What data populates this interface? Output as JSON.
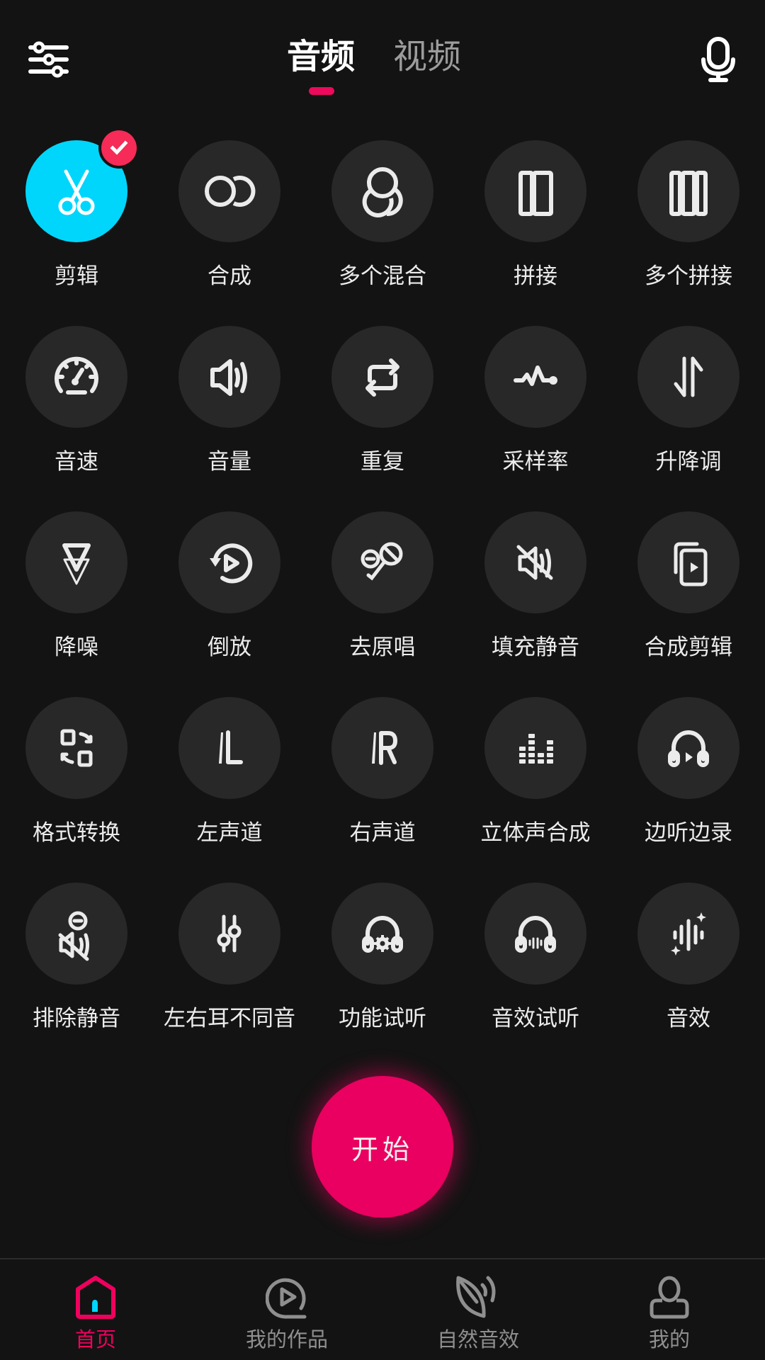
{
  "header": {
    "settings_icon": "sliders-icon",
    "mic_icon": "microphone-icon",
    "tabs": [
      {
        "label": "音频",
        "active": true
      },
      {
        "label": "视频",
        "active": false
      }
    ]
  },
  "tools": [
    {
      "label": "剪辑",
      "icon": "scissors-icon",
      "selected": true
    },
    {
      "label": "合成",
      "icon": "merge-circles-icon"
    },
    {
      "label": "多个混合",
      "icon": "multi-mix-icon"
    },
    {
      "label": "拼接",
      "icon": "splice-icon"
    },
    {
      "label": "多个拼接",
      "icon": "multi-splice-icon"
    },
    {
      "label": "音速",
      "icon": "speedometer-icon"
    },
    {
      "label": "音量",
      "icon": "volume-icon"
    },
    {
      "label": "重复",
      "icon": "repeat-icon"
    },
    {
      "label": "采样率",
      "icon": "sample-rate-icon"
    },
    {
      "label": "升降调",
      "icon": "pitch-arrows-icon"
    },
    {
      "label": "降噪",
      "icon": "denoise-icon"
    },
    {
      "label": "倒放",
      "icon": "reverse-play-icon"
    },
    {
      "label": "去原唱",
      "icon": "remove-vocal-icon"
    },
    {
      "label": "填充静音",
      "icon": "fill-silence-icon"
    },
    {
      "label": "合成剪辑",
      "icon": "merge-clip-icon"
    },
    {
      "label": "格式转换",
      "icon": "format-convert-icon"
    },
    {
      "label": "左声道",
      "icon": "left-channel-icon"
    },
    {
      "label": "右声道",
      "icon": "right-channel-icon"
    },
    {
      "label": "立体声合成",
      "icon": "stereo-equalizer-icon"
    },
    {
      "label": "边听边录",
      "icon": "listen-record-icon"
    },
    {
      "label": "排除静音",
      "icon": "remove-silence-icon"
    },
    {
      "label": "左右耳不同音",
      "icon": "balance-sliders-icon"
    },
    {
      "label": "功能试听",
      "icon": "headphones-gear-icon"
    },
    {
      "label": "音效试听",
      "icon": "headphones-wave-icon"
    },
    {
      "label": "音效",
      "icon": "sound-effect-sparkle-icon"
    }
  ],
  "start_button": {
    "label": "开始"
  },
  "bottom_nav": [
    {
      "label": "首页",
      "icon": "home-icon",
      "active": true
    },
    {
      "label": "我的作品",
      "icon": "my-works-play-icon",
      "active": false
    },
    {
      "label": "自然音效",
      "icon": "nature-leaf-sound-icon",
      "active": false
    },
    {
      "label": "我的",
      "icon": "profile-icon",
      "active": false
    }
  ],
  "colors": {
    "background": "#131313",
    "accent": "#ea0060",
    "selected_tool": "#00d6fb",
    "badge": "#f62b57",
    "tool_circle": "#282828",
    "inactive_text": "#8f8f8f"
  }
}
